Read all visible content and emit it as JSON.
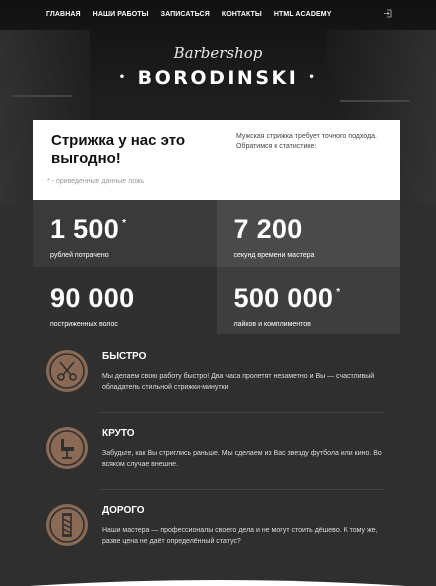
{
  "nav": {
    "items": [
      "ГЛАВНАЯ",
      "НАШИ РАБОТЫ",
      "ЗАПИСАТЬСЯ",
      "КОНТАКТЫ",
      "HTML ACADEMY"
    ],
    "login_icon": "login-icon"
  },
  "logo": {
    "script": "Barbershop",
    "main": "BORODINSKI",
    "separator": "•"
  },
  "promo": {
    "title": "Стрижка у нас это выгодно!",
    "note": "* - приведенные данные ложь",
    "description": "Мужская стрижка требует точного подхода. Обратимся к статистике:"
  },
  "stats": [
    {
      "number": "1 500",
      "mark": "*",
      "label": "рублей потрачено"
    },
    {
      "number": "7 200",
      "mark": "",
      "label": "секунд времени мастера"
    },
    {
      "number": "90 000",
      "mark": "",
      "label": "постриженных волос"
    },
    {
      "number": "500 000",
      "mark": "*",
      "label": "лайков и комплиментов"
    }
  ],
  "features": [
    {
      "title": "БЫСТРО",
      "text": "Мы делаем свою работу быстро! Два часа пролетят незаметно и Вы — счастливый обладатель стильной стрижки-минутки",
      "icon": "scissors-icon"
    },
    {
      "title": "КРУТО",
      "text": "Забудьте, как Вы стриглись раньше. Мы сделаем из Вас звезду футбола или кино. Во всяком случае внешне.",
      "icon": "barber-chair-icon"
    },
    {
      "title": "ДОРОГО",
      "text": "Наши мастера — профессионалы своего дела и не могут стоить дёшево. К тому же, разве цена не даёт определённый статус?",
      "icon": "barber-pole-icon"
    }
  ],
  "colors": {
    "accent": "#8a6a55",
    "background": "#2f2f2f",
    "card": "#ffffff"
  }
}
